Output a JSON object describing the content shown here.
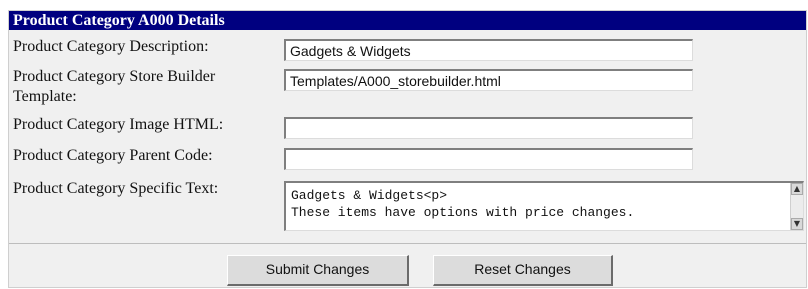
{
  "header": {
    "title": "Product Category A000 Details"
  },
  "fields": [
    {
      "label": "Product Category Description:",
      "value": "Gadgets & Widgets"
    },
    {
      "label": "Product Category Store Builder Template:",
      "value": "Templates/A000_storebuilder.html"
    },
    {
      "label": "Product Category Image HTML:",
      "value": ""
    },
    {
      "label": "Product Category Parent Code:",
      "value": ""
    }
  ],
  "specific_text": {
    "label": "Product Category Specific Text:",
    "lines": [
      "Gadgets & Widgets<p>",
      "These items have options with price changes."
    ]
  },
  "scrollbar": {
    "up_glyph": "▲",
    "down_glyph": "▼"
  },
  "buttons": {
    "submit_label": "Submit Changes",
    "reset_label": "Reset Changes"
  },
  "colors": {
    "header_bg": "#000080",
    "header_text": "#ffffff",
    "panel_bg": "#f0f0f0"
  }
}
